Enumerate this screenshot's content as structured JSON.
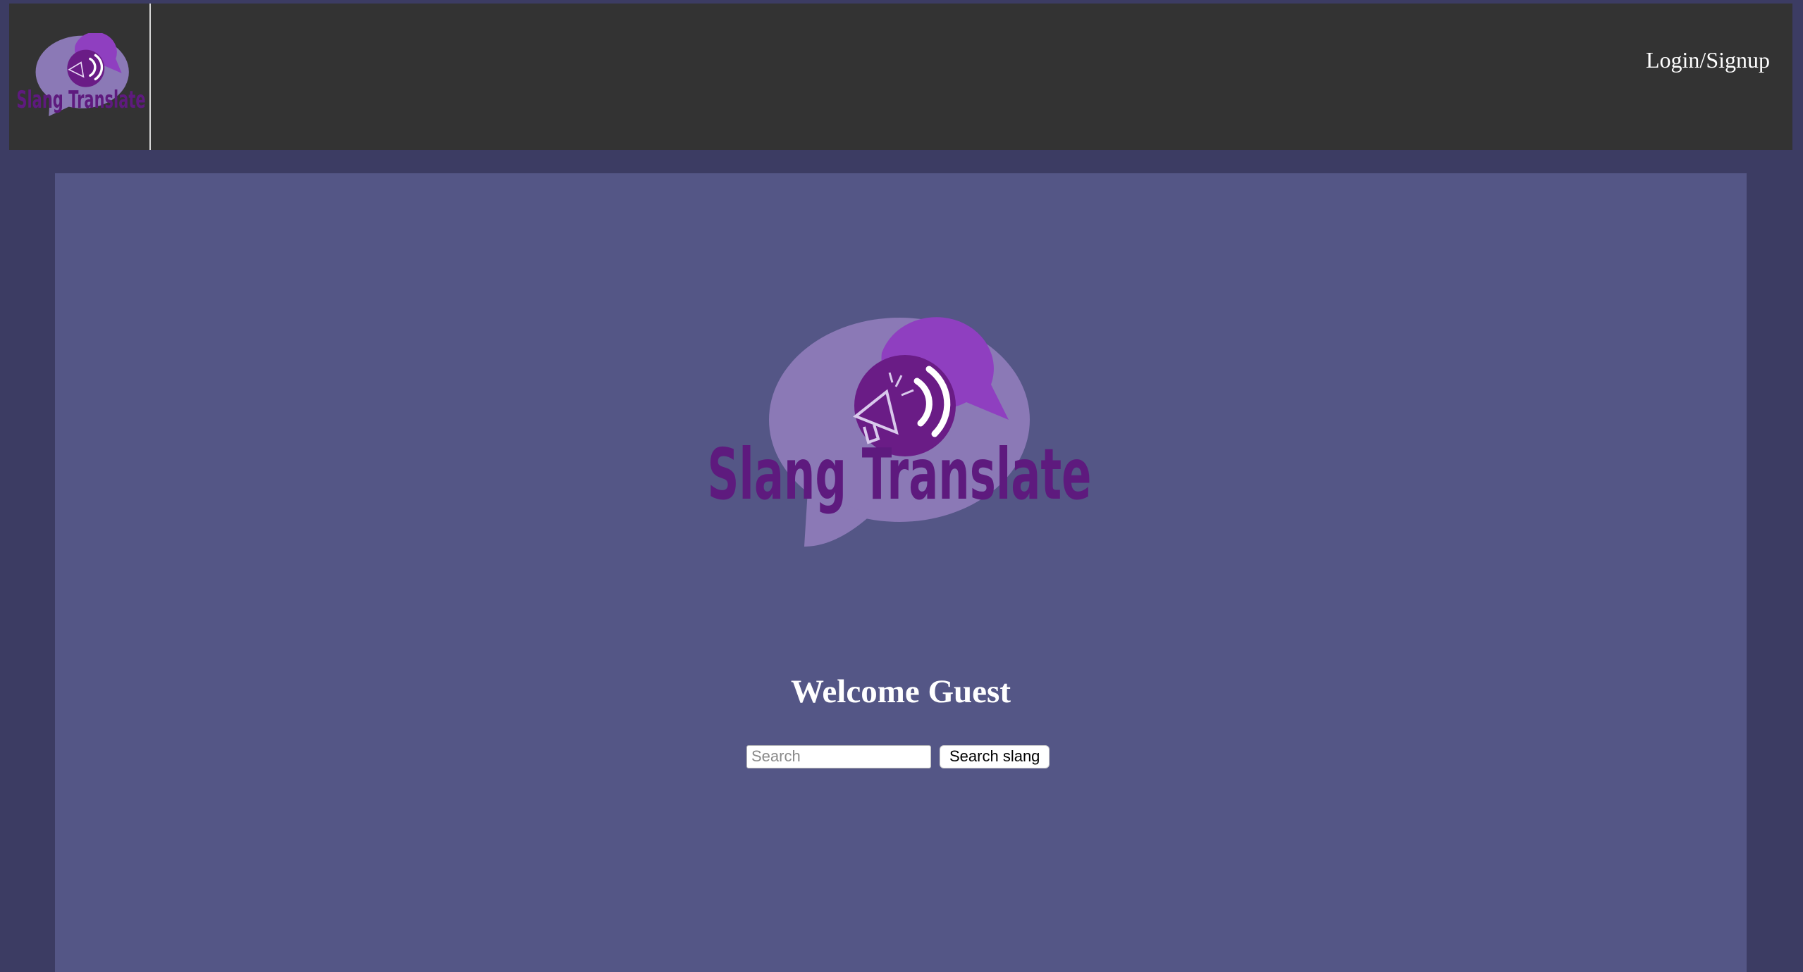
{
  "header": {
    "logo_text": "Slang Translate",
    "login_label": "Login/Signup"
  },
  "main": {
    "logo_text": "Slang Translate",
    "welcome_text": "Welcome Guest",
    "search": {
      "placeholder": "Search",
      "value": "",
      "button_label": "Search slang"
    }
  },
  "colors": {
    "page_background": "#3c3c63",
    "header_background": "#333333",
    "content_background": "#545686",
    "logo_bubble_light": "#8b79b6",
    "logo_bubble_accent": "#8f3fc0",
    "logo_text": "#5e1a7e"
  },
  "icons": [
    "slang-translate-logo",
    "megaphone-icon"
  ]
}
